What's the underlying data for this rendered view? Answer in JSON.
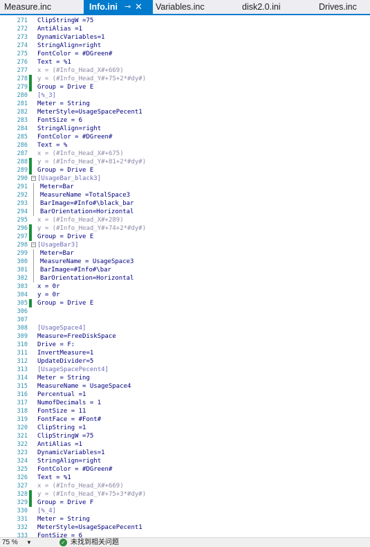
{
  "tabs": [
    {
      "label": "Measure.inc",
      "active": false
    },
    {
      "label": "Info.ini",
      "active": true
    },
    {
      "label": "Variables.inc",
      "active": false
    },
    {
      "label": "disk2.0.ini",
      "active": false
    },
    {
      "label": "Drives.inc",
      "active": false
    }
  ],
  "editor": {
    "lines": [
      {
        "n": "271",
        "text": "ClipStringW =75",
        "changed": false
      },
      {
        "n": "272",
        "text": "AntiAlias =1",
        "changed": false
      },
      {
        "n": "273",
        "text": "DynamicVariables=1",
        "changed": false
      },
      {
        "n": "274",
        "text": "StringAlign=right",
        "changed": false
      },
      {
        "n": "275",
        "text": "FontColor = #DGreen#",
        "changed": false
      },
      {
        "n": "276",
        "text": "Text = %1",
        "changed": false
      },
      {
        "n": "277",
        "text": "x = (#Info_Head_X#+669)",
        "changed": false
      },
      {
        "n": "278",
        "text": "y = (#Info_Head_Y#+75+2*#dy#)",
        "changed": true
      },
      {
        "n": "279",
        "text": "Group = Drive E",
        "changed": true
      },
      {
        "n": "280",
        "text": "[%_3]",
        "changed": false
      },
      {
        "n": "281",
        "text": "Meter = String",
        "changed": false
      },
      {
        "n": "282",
        "text": "MeterStyle=UsageSpacePecent1",
        "changed": false
      },
      {
        "n": "283",
        "text": "FontSize = 6",
        "changed": false
      },
      {
        "n": "284",
        "text": "StringAlign=right",
        "changed": false
      },
      {
        "n": "285",
        "text": "FontColor = #DGreen#",
        "changed": false
      },
      {
        "n": "286",
        "text": "Text = %",
        "changed": false
      },
      {
        "n": "287",
        "text": "x = (#Info_Head_X#+675)",
        "changed": false
      },
      {
        "n": "288",
        "text": "y = (#Info_Head_Y#+81+2*#dy#)",
        "changed": true
      },
      {
        "n": "289",
        "text": "Group = Drive E",
        "changed": true
      },
      {
        "n": "290",
        "text": "[UsageBar_black3]",
        "changed": false,
        "fold": "-"
      },
      {
        "n": "291",
        "text": "Meter=Bar",
        "changed": false,
        "guide": true
      },
      {
        "n": "292",
        "text": "MeasureName =TotalSpace3",
        "changed": false,
        "guide": true
      },
      {
        "n": "293",
        "text": "BarImage=#Info#\\black_bar",
        "changed": false,
        "guide": true
      },
      {
        "n": "294",
        "text": "BarOrientation=Horizontal",
        "changed": false,
        "guide": true
      },
      {
        "n": "295",
        "text": "x = (#Info_Head_X#+289)",
        "changed": false
      },
      {
        "n": "296",
        "text": "y = (#Info_Head_Y#+74+2*#dy#)",
        "changed": true
      },
      {
        "n": "297",
        "text": "Group = Drive E",
        "changed": true
      },
      {
        "n": "298",
        "text": "[UsageBar3]",
        "changed": false,
        "fold": "-"
      },
      {
        "n": "299",
        "text": "Meter=Bar",
        "changed": false,
        "guide": true
      },
      {
        "n": "300",
        "text": "MeasureName = UsageSpace3",
        "changed": false,
        "guide": true
      },
      {
        "n": "301",
        "text": "BarImage=#Info#\\bar",
        "changed": false,
        "guide": true
      },
      {
        "n": "302",
        "text": "BarOrientation=Horizontal",
        "changed": false,
        "guide": true
      },
      {
        "n": "303",
        "text": "x = 0r",
        "changed": false
      },
      {
        "n": "304",
        "text": "y = 0r",
        "changed": false
      },
      {
        "n": "305",
        "text": "Group = Drive E",
        "changed": true
      },
      {
        "n": "306",
        "text": "",
        "changed": false
      },
      {
        "n": "307",
        "text": "",
        "changed": false
      },
      {
        "n": "308",
        "text": "[UsageSpace4]",
        "changed": false
      },
      {
        "n": "309",
        "text": "Measure=FreeDiskSpace",
        "changed": false
      },
      {
        "n": "310",
        "text": "Drive = F:",
        "changed": false
      },
      {
        "n": "311",
        "text": "InvertMeasure=1",
        "changed": false
      },
      {
        "n": "312",
        "text": "UpdateDivider=5",
        "changed": false
      },
      {
        "n": "313",
        "text": "[UsageSpacePecent4]",
        "changed": false
      },
      {
        "n": "314",
        "text": "Meter = String",
        "changed": false
      },
      {
        "n": "315",
        "text": "MeasureName = UsageSpace4",
        "changed": false
      },
      {
        "n": "316",
        "text": "Percentual =1",
        "changed": false
      },
      {
        "n": "317",
        "text": "NumofDecimals = 1",
        "changed": false
      },
      {
        "n": "318",
        "text": "FontSize = 11",
        "changed": false
      },
      {
        "n": "319",
        "text": "FontFace = #Font#",
        "changed": false
      },
      {
        "n": "320",
        "text": "ClipString =1",
        "changed": false
      },
      {
        "n": "321",
        "text": "ClipStringW =75",
        "changed": false
      },
      {
        "n": "322",
        "text": "AntiAlias =1",
        "changed": false
      },
      {
        "n": "323",
        "text": "DynamicVariables=1",
        "changed": false
      },
      {
        "n": "324",
        "text": "StringAlign=right",
        "changed": false
      },
      {
        "n": "325",
        "text": "FontColor = #DGreen#",
        "changed": false
      },
      {
        "n": "326",
        "text": "Text = %1",
        "changed": false
      },
      {
        "n": "327",
        "text": "x = (#Info_Head_X#+669)",
        "changed": false
      },
      {
        "n": "328",
        "text": "y = (#Info_Head_Y#+75+3*#dy#)",
        "changed": true
      },
      {
        "n": "329",
        "text": "Group = Drive F",
        "changed": true
      },
      {
        "n": "330",
        "text": "[%_4]",
        "changed": false
      },
      {
        "n": "331",
        "text": "Meter = String",
        "changed": false
      },
      {
        "n": "332",
        "text": "MeterStyle=UsageSpacePecent1",
        "changed": false
      },
      {
        "n": "333",
        "text": "FontSize = 6",
        "changed": false
      }
    ]
  },
  "status": {
    "zoom": "75 %",
    "zoom_icon": "chevron-down-icon",
    "ok_icon": "check-circle-icon",
    "message": "未找到相关问题"
  },
  "colors": {
    "accent": "#007acc",
    "line_number": "#2b91af",
    "change_marker": "#1a8f3a",
    "keyword": "#000080",
    "section": "#6b6bb8",
    "expression": "#8a8aa8",
    "ok": "#2e8b3e"
  }
}
